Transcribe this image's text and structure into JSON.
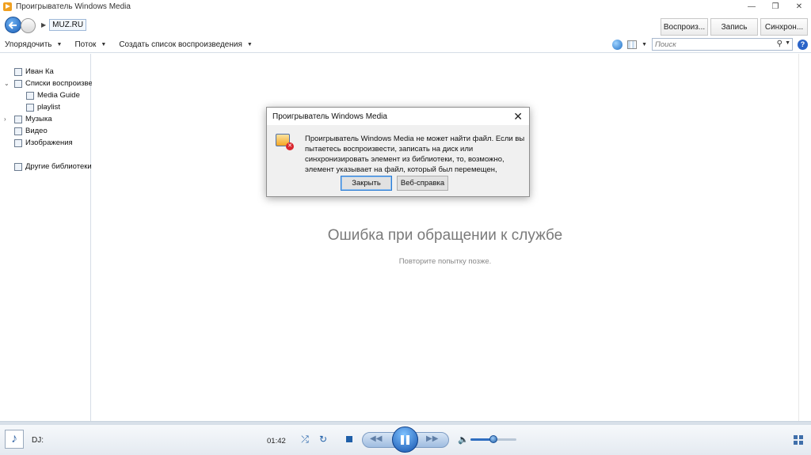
{
  "window": {
    "title": "Проигрыватель Windows Media",
    "controls": [
      "—",
      "❐",
      "✕"
    ]
  },
  "nav": {
    "breadcrumb": "MUZ.RU",
    "tabs": [
      "Воспроиз...",
      "Запись",
      "Синхрон..."
    ]
  },
  "toolbar": {
    "items": [
      "Упорядочить",
      "Поток",
      "Создать список воспроизведения"
    ],
    "search_placeholder": "Поиск"
  },
  "sidebar": {
    "items": [
      {
        "label": "Иван Ка",
        "icon": "user-library-icon"
      },
      {
        "label": "Списки воспроизведения",
        "icon": "playlists-icon"
      },
      {
        "label": "Media Guide",
        "icon": "playlist-icon"
      },
      {
        "label": "playlist",
        "icon": "playlist-icon"
      },
      {
        "label": "Музыка",
        "icon": "music-note-icon"
      },
      {
        "label": "Видео",
        "icon": "video-icon"
      },
      {
        "label": "Изображения",
        "icon": "pictures-icon"
      },
      {
        "label": "Другие библиотеки",
        "icon": "other-libraries-icon"
      }
    ]
  },
  "main": {
    "error_title": "Ошибка при обращении к службе",
    "error_subtitle": "Повторите попытку позже."
  },
  "dialog": {
    "title": "Проигрыватель Windows Media",
    "message": "Проигрыватель Windows Media не может найти файл. Если вы пытаетесь воспроизвести, записать на диск или синхронизировать элемент из библиотеки, то, возможно, элемент указывает на файл, который был перемещен,",
    "close_button": "Закрыть",
    "help_button": "Веб-справка"
  },
  "player": {
    "now_playing": "DJ:",
    "time": "01:42",
    "state": "playing",
    "volume": 0.5
  },
  "colors": {
    "accent": "#1f5fa8",
    "error_text": "#7a7a7a"
  }
}
